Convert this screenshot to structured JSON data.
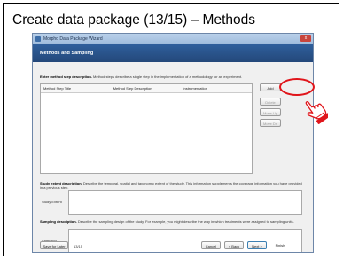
{
  "slide": {
    "title": "Create data package (13/15) – Methods"
  },
  "window": {
    "title": "Morpho Data Package Wizard",
    "close_label": "x",
    "header": "Methods and Sampling"
  },
  "method_steps": {
    "instruction_bold": "Enter method step description.",
    "instruction_text": " Method steps describe a single step in the implementation of a methodology for an experiment.",
    "columns": [
      "Method Step Title",
      "Method Step Description",
      "Instrumentation"
    ],
    "add_label": "Add",
    "delete_label": "Delete",
    "move_up_label": "Move Up",
    "move_down_label": "Move Dn"
  },
  "study_extent": {
    "desc_bold": "Study extent description.",
    "desc_text": " Describe the temporal, spatial and taxonomic extent of the study. This information supplements the coverage information you have provided in a previous step.",
    "label": "Study Extent",
    "value": ""
  },
  "sampling": {
    "desc_bold": "Sampling description.",
    "desc_text": " Describe the sampling design of the study. For example, you might describe the way in which treatments were assigned to sampling units.",
    "label": "Sampling",
    "value": ""
  },
  "footer": {
    "save_later_label": "Save for Later",
    "page_indicator": "13/15",
    "cancel_label": "Cancel",
    "back_label": "< Back",
    "next_label": "Next >",
    "finish_label": "Finish"
  },
  "annotation": {
    "highlight_color": "#e0151b",
    "cursor_icon": "hand-pointer-icon"
  }
}
